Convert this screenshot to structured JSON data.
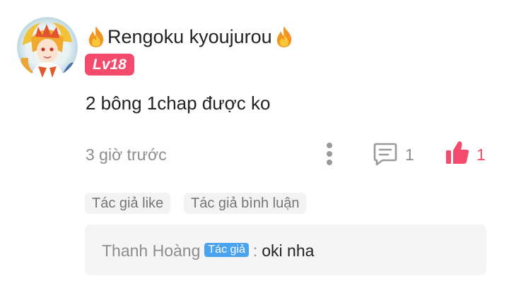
{
  "comment": {
    "username": "Rengoku kyoujurou",
    "level": "Lv18",
    "text": "2 bông 1chap được ko",
    "time": "3 giờ trước",
    "reply_count": "1",
    "like_count": "1",
    "tags": [
      "Tác giả like",
      "Tác giả bình luận"
    ],
    "decorations": [
      "fire-icon",
      "fire-icon"
    ]
  },
  "reply": {
    "author": "Thanh Hoàng",
    "badge": "Tác giả",
    "separator": ":",
    "text": "oki nha"
  },
  "colors": {
    "accent": "#f44a6b",
    "badge_blue": "#4aa3ec",
    "muted_text": "#8d8d8d",
    "tag_bg": "#f3f3f3",
    "reply_bg": "#f5f5f5"
  }
}
